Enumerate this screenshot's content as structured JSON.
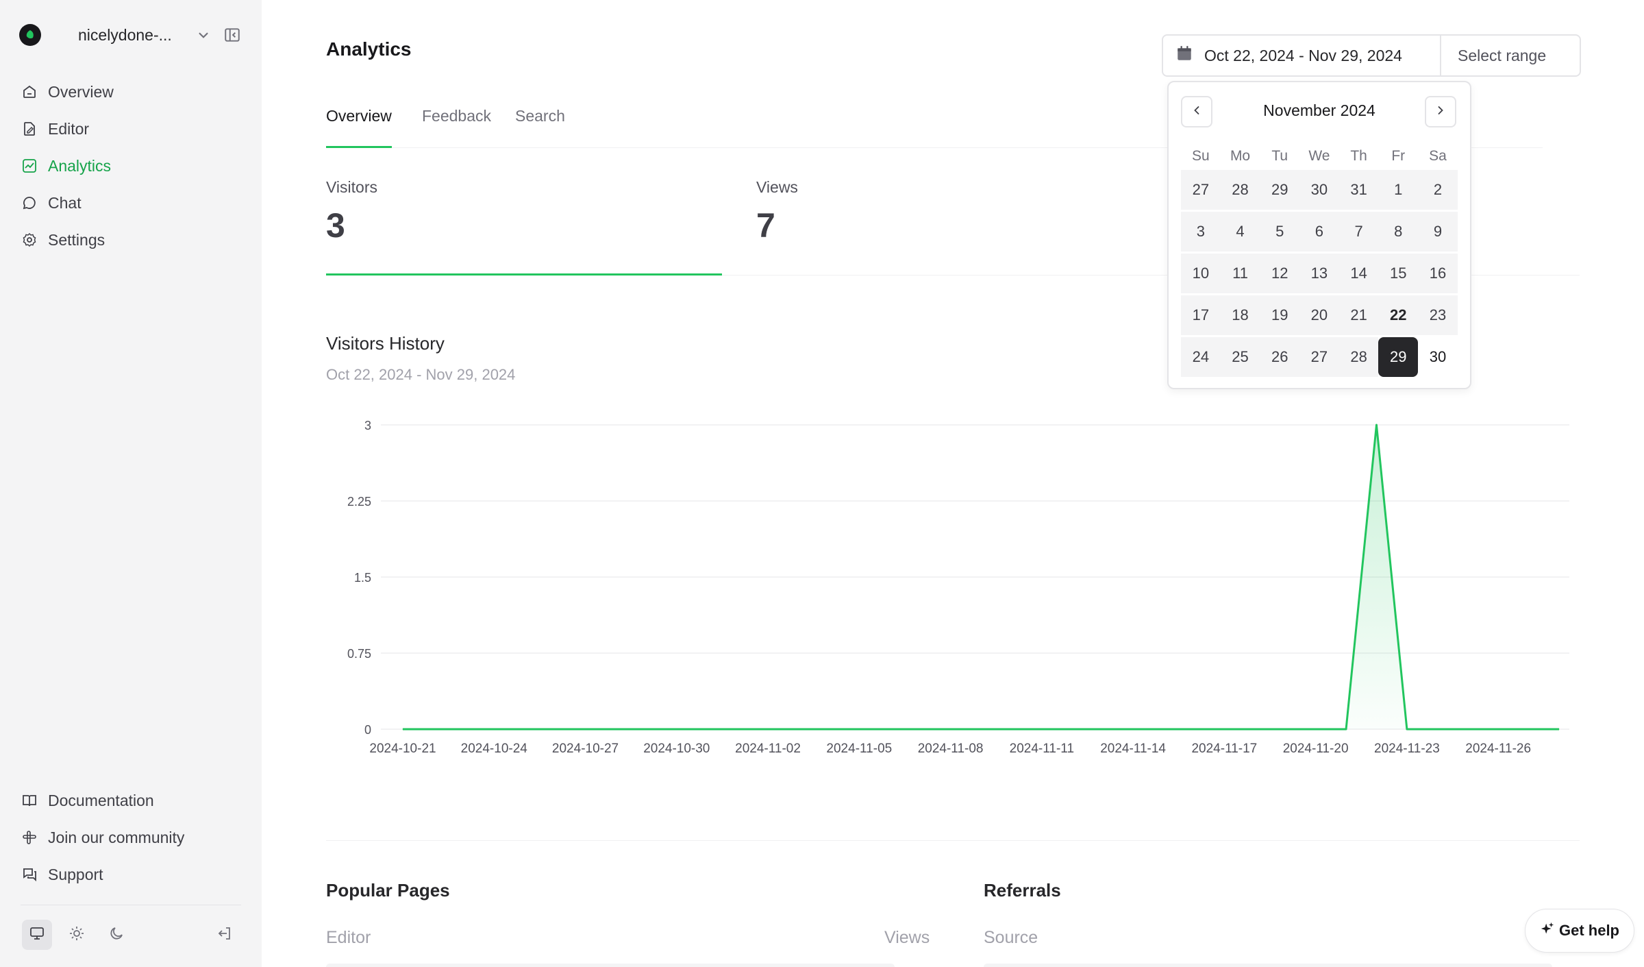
{
  "workspace": {
    "name": "nicelydone-..."
  },
  "sidebar": {
    "items": [
      {
        "label": "Overview",
        "icon": "home-icon"
      },
      {
        "label": "Editor",
        "icon": "edit-icon"
      },
      {
        "label": "Analytics",
        "icon": "chart-icon",
        "active": true
      },
      {
        "label": "Chat",
        "icon": "chat-icon"
      },
      {
        "label": "Settings",
        "icon": "gear-icon"
      }
    ],
    "footer": [
      {
        "label": "Documentation",
        "icon": "book-icon"
      },
      {
        "label": "Join our community",
        "icon": "slack-icon"
      },
      {
        "label": "Support",
        "icon": "support-icon"
      }
    ]
  },
  "page": {
    "title": "Analytics"
  },
  "date_picker": {
    "range": "Oct 22, 2024 - Nov 29, 2024",
    "select_label": "Select range"
  },
  "tabs": [
    {
      "label": "Overview",
      "active": true
    },
    {
      "label": "Feedback"
    },
    {
      "label": "Search"
    }
  ],
  "stats": [
    {
      "label": "Visitors",
      "value": "3"
    },
    {
      "label": "Views",
      "value": "7"
    }
  ],
  "history": {
    "title": "Visitors History",
    "range": "Oct 22, 2024 - Nov 29, 2024"
  },
  "calendar": {
    "month": "November 2024",
    "weekdays": [
      "Su",
      "Mo",
      "Tu",
      "We",
      "Th",
      "Fr",
      "Sa"
    ],
    "weeks": [
      [
        "27",
        "28",
        "29",
        "30",
        "31",
        "1",
        "2"
      ],
      [
        "3",
        "4",
        "5",
        "6",
        "7",
        "8",
        "9"
      ],
      [
        "10",
        "11",
        "12",
        "13",
        "14",
        "15",
        "16"
      ],
      [
        "17",
        "18",
        "19",
        "20",
        "21",
        "22",
        "23"
      ],
      [
        "24",
        "25",
        "26",
        "27",
        "28",
        "29",
        "30"
      ]
    ],
    "today": "22",
    "selected": "29"
  },
  "popular_pages": {
    "title": "Popular Pages",
    "col1": "Editor",
    "col2": "Views"
  },
  "referrals": {
    "title": "Referrals",
    "col1": "Source"
  },
  "help": {
    "label": "Get help"
  },
  "colors": {
    "accent": "#22c55e",
    "active_nav": "#16a34a"
  },
  "chart_data": {
    "type": "area",
    "x": [
      "2024-10-21",
      "2024-10-22",
      "2024-10-23",
      "2024-10-24",
      "2024-10-25",
      "2024-10-26",
      "2024-10-27",
      "2024-10-28",
      "2024-10-29",
      "2024-10-30",
      "2024-10-31",
      "2024-11-01",
      "2024-11-02",
      "2024-11-03",
      "2024-11-04",
      "2024-11-05",
      "2024-11-06",
      "2024-11-07",
      "2024-11-08",
      "2024-11-09",
      "2024-11-10",
      "2024-11-11",
      "2024-11-12",
      "2024-11-13",
      "2024-11-14",
      "2024-11-15",
      "2024-11-16",
      "2024-11-17",
      "2024-11-18",
      "2024-11-19",
      "2024-11-20",
      "2024-11-21",
      "2024-11-22",
      "2024-11-23",
      "2024-11-24",
      "2024-11-25",
      "2024-11-26",
      "2024-11-27",
      "2024-11-28"
    ],
    "values": [
      0,
      0,
      0,
      0,
      0,
      0,
      0,
      0,
      0,
      0,
      0,
      0,
      0,
      0,
      0,
      0,
      0,
      0,
      0,
      0,
      0,
      0,
      0,
      0,
      0,
      0,
      0,
      0,
      0,
      0,
      0,
      0,
      3,
      0,
      0,
      0,
      0,
      0,
      0
    ],
    "x_tick_labels": [
      "2024-10-21",
      "2024-10-24",
      "2024-10-27",
      "2024-10-30",
      "2024-11-02",
      "2024-11-05",
      "2024-11-08",
      "2024-11-11",
      "2024-11-14",
      "2024-11-17",
      "2024-11-20",
      "2024-11-23",
      "2024-11-26"
    ],
    "y_ticks": [
      "0",
      "0.75",
      "1.5",
      "2.25",
      "3"
    ],
    "ylim": [
      0,
      3
    ],
    "grid": true,
    "color": "#22c55e"
  }
}
